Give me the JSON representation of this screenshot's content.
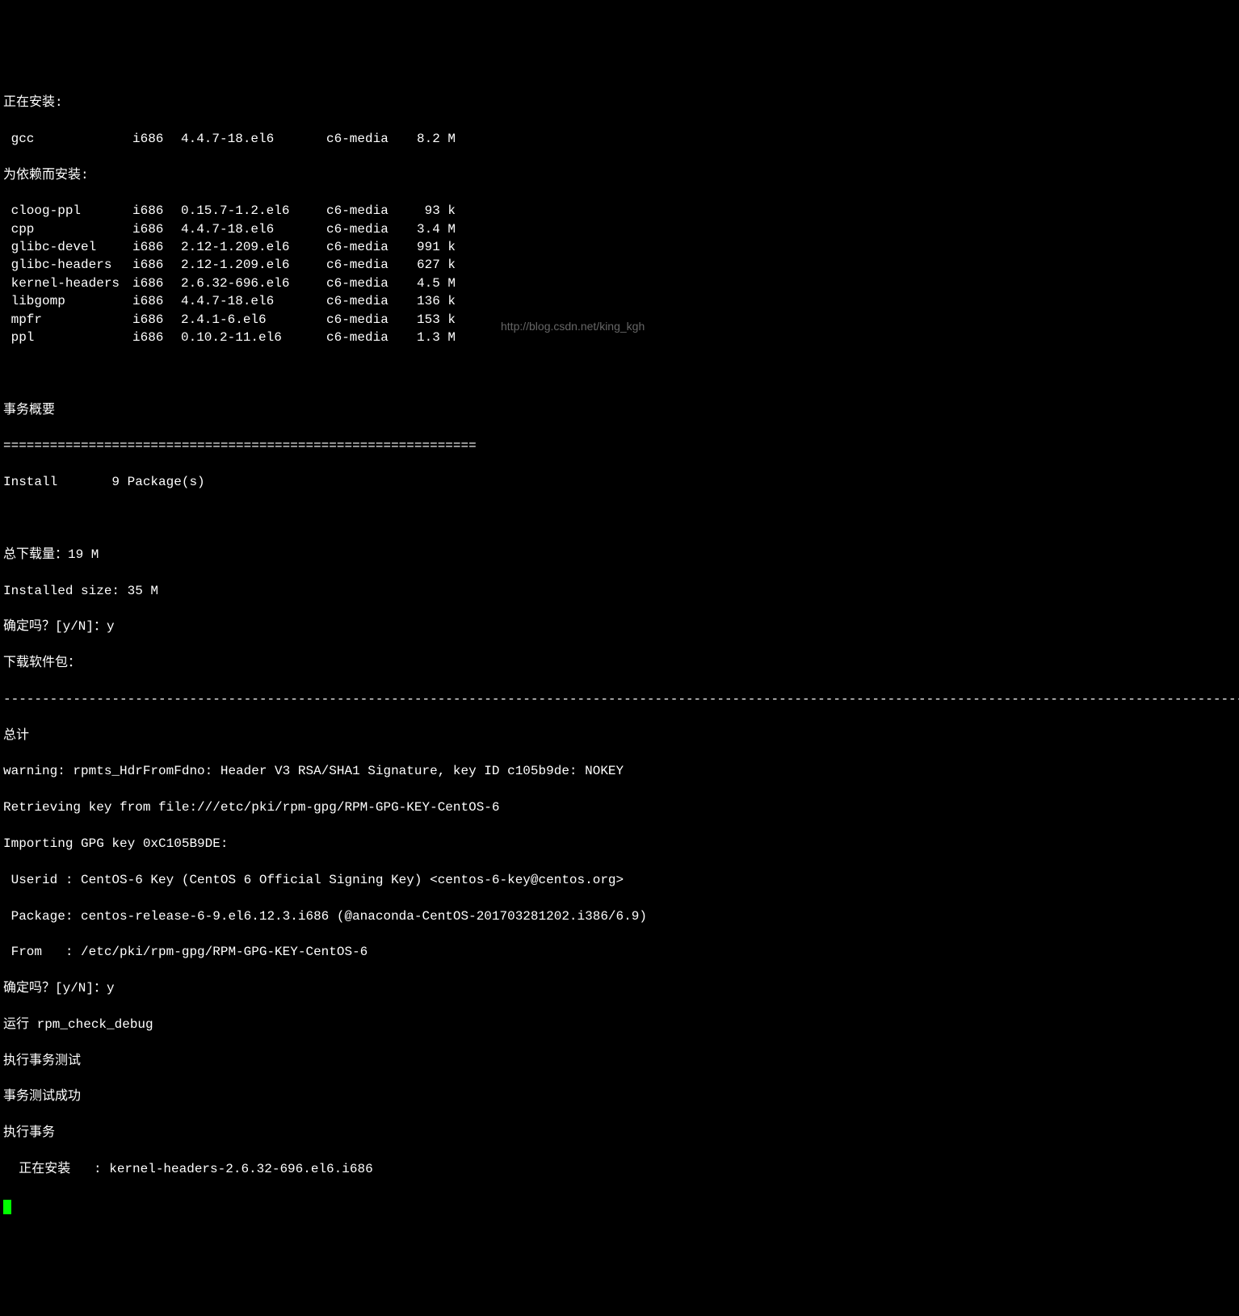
{
  "headers": {
    "installing": "正在安装:",
    "deps": "为依赖而安装:",
    "summary": "事务概要",
    "total": "总计"
  },
  "main_pkg": {
    "name": " gcc",
    "arch": "i686",
    "version": "4.4.7-18.el6",
    "repo": "c6-media",
    "size": "8.2 M"
  },
  "deps": [
    {
      "name": " cloog-ppl",
      "arch": "i686",
      "version": "0.15.7-1.2.el6",
      "repo": "c6-media",
      "size": " 93 k"
    },
    {
      "name": " cpp",
      "arch": "i686",
      "version": "4.4.7-18.el6",
      "repo": "c6-media",
      "size": "3.4 M"
    },
    {
      "name": " glibc-devel",
      "arch": "i686",
      "version": "2.12-1.209.el6",
      "repo": "c6-media",
      "size": "991 k"
    },
    {
      "name": " glibc-headers",
      "arch": "i686",
      "version": "2.12-1.209.el6",
      "repo": "c6-media",
      "size": "627 k"
    },
    {
      "name": " kernel-headers",
      "arch": "i686",
      "version": "2.6.32-696.el6",
      "repo": "c6-media",
      "size": "4.5 M"
    },
    {
      "name": " libgomp",
      "arch": "i686",
      "version": "4.4.7-18.el6",
      "repo": "c6-media",
      "size": "136 k"
    },
    {
      "name": " mpfr",
      "arch": "i686",
      "version": "2.4.1-6.el6",
      "repo": "c6-media",
      "size": "153 k"
    },
    {
      "name": " ppl",
      "arch": "i686",
      "version": "0.10.2-11.el6",
      "repo": "c6-media",
      "size": "1.3 M"
    }
  ],
  "divider_eq": "=============================================================",
  "install_count": "Install       9 Package(s)",
  "download_size": "总下载量：19 M",
  "installed_size": "Installed size: 35 M",
  "confirm1": "确定吗？[y/N]：y",
  "downloading": "下载软件包：",
  "divider_dash": "--------------------------------------------------------------------------------------------------------------------------------------------------------------------------",
  "warning": "warning: rpmts_HdrFromFdno: Header V3 RSA/SHA1 Signature, key ID c105b9de: NOKEY",
  "retrieving": "Retrieving key from file:///etc/pki/rpm-gpg/RPM-GPG-KEY-CentOS-6",
  "importing": "Importing GPG key 0xC105B9DE:",
  "userid": " Userid : CentOS-6 Key (CentOS 6 Official Signing Key) <centos-6-key@centos.org>",
  "package": " Package: centos-release-6-9.el6.12.3.i686 (@anaconda-CentOS-201703281202.i386/6.9)",
  "from": " From   : /etc/pki/rpm-gpg/RPM-GPG-KEY-CentOS-6",
  "confirm2": "确定吗？[y/N]：y",
  "running_rpm": "运行 rpm_check_debug",
  "test_run": "执行事务测试",
  "test_ok": "事务测试成功",
  "exec": "执行事务",
  "installing_pkg": "  正在安装   : kernel-headers-2.6.32-696.el6.i686",
  "watermark": "http://blog.csdn.net/king_kgh"
}
